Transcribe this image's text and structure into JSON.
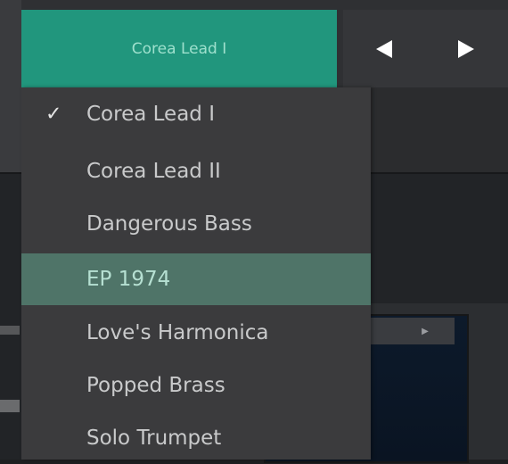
{
  "header": {
    "preset_name": "Corea Lead I",
    "prev_icon": "left-triangle-icon",
    "next_icon": "right-triangle-icon"
  },
  "menu": {
    "selected": "Corea Lead I",
    "highlighted": "EP 1974",
    "items": [
      {
        "label": "Corea Lead I",
        "checked": true
      },
      {
        "label": "Corea Lead II"
      },
      {
        "label": "Dangerous Bass"
      },
      {
        "label": "EP 1974",
        "highlighted": true
      },
      {
        "label": "Love's Harmonica"
      },
      {
        "label": "Popped Brass"
      },
      {
        "label": "Solo Trumpet"
      }
    ]
  },
  "colors": {
    "accent": "#21967d",
    "highlight": "#4f7468",
    "menu_bg": "#3b3b3d"
  }
}
